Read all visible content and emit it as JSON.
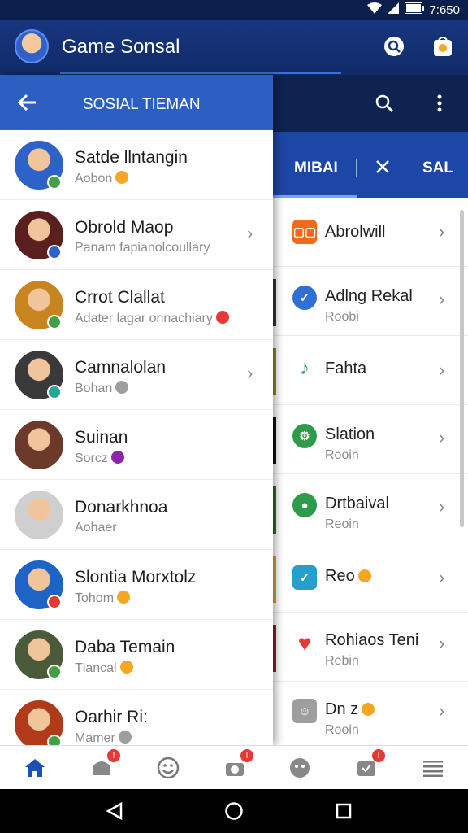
{
  "status_bar": {
    "time": "7:650"
  },
  "app_bar": {
    "title": "Game Sonsal"
  },
  "right_panel": {
    "tabs": [
      {
        "label": "MIBAI"
      },
      {
        "label": "SAL"
      }
    ],
    "items": [
      {
        "title": "Abrolwill",
        "subtitle": "",
        "icon_color": "#f06a1c",
        "icon_glyph": "ID"
      },
      {
        "title": "Adlng Rekal",
        "subtitle": "Roobi",
        "icon_color": "#2f6fd6",
        "icon_glyph": ""
      },
      {
        "title": "Fahta",
        "subtitle": "",
        "icon_color": "#ffffff",
        "icon_glyph": ""
      },
      {
        "title": "Slation",
        "subtitle": "Rooin",
        "icon_color": "#2e9b4a",
        "icon_glyph": ""
      },
      {
        "title": "Drtbaival",
        "subtitle": "Reoin",
        "icon_color": "#2e9b4a",
        "icon_glyph": ""
      },
      {
        "title": "Reo",
        "subtitle": "",
        "icon_color": "#26a0c9",
        "icon_glyph": ""
      },
      {
        "title": "Rohiaos Teni",
        "subtitle": "Rebin",
        "icon_color": "#e53935",
        "icon_glyph": ""
      },
      {
        "title": "Dn z",
        "subtitle": "Rooin",
        "icon_color": "#9e9e9e",
        "icon_glyph": ""
      }
    ]
  },
  "drawer": {
    "title": "SOSIAL TIEMAN",
    "friends": [
      {
        "name": "Satde llntangin",
        "status": "Aobon",
        "avatar_color": "#2d63c9",
        "dot_color": "#43a047",
        "badge_color": "#f5a623"
      },
      {
        "name": "Obrold Maop",
        "status": "Panam fapianolcoullary",
        "avatar_color": "#5a1f1f",
        "dot_color": "#2d63c9",
        "badge_color": ""
      },
      {
        "name": "Crrot Clallat",
        "status": "Adater lagar onnachiary",
        "avatar_color": "#c8841f",
        "dot_color": "#43a047",
        "badge_color": "#e53935"
      },
      {
        "name": "Camnalolan",
        "status": "Bohan",
        "avatar_color": "#3a3a3a",
        "dot_color": "#26a69a",
        "badge_color": "#9e9e9e"
      },
      {
        "name": "Suinan",
        "status": "Sorcz",
        "avatar_color": "#6b3a2a",
        "dot_color": "",
        "badge_color": "#8e24aa"
      },
      {
        "name": "Donarkhnoa",
        "status": "Aohaer",
        "avatar_color": "#cfcfcf",
        "dot_color": "",
        "badge_color": ""
      },
      {
        "name": "Slontia Morxtolz",
        "status": "Tohom",
        "avatar_color": "#1e63c6",
        "dot_color": "#e53935",
        "badge_color": "#f5a623"
      },
      {
        "name": "Daba Temain",
        "status": "Tlancal",
        "avatar_color": "#4a5a3a",
        "dot_color": "#43a047",
        "badge_color": "#f5a623"
      },
      {
        "name": "Oarhir Ri:",
        "status": "Mamer",
        "avatar_color": "#b03a1a",
        "dot_color": "#43a047",
        "badge_color": "#9e9e9e"
      }
    ]
  },
  "bottom_nav": [
    {
      "name": "home",
      "badge": ""
    },
    {
      "name": "games",
      "badge": "!"
    },
    {
      "name": "emoji",
      "badge": ""
    },
    {
      "name": "camera",
      "badge": "!"
    },
    {
      "name": "friends",
      "badge": ""
    },
    {
      "name": "messages",
      "badge": "!"
    },
    {
      "name": "menu",
      "badge": ""
    }
  ],
  "colors": {
    "primary": "#2d5fc3",
    "appbar": "#17367f",
    "accent": "#7aa2ff"
  }
}
